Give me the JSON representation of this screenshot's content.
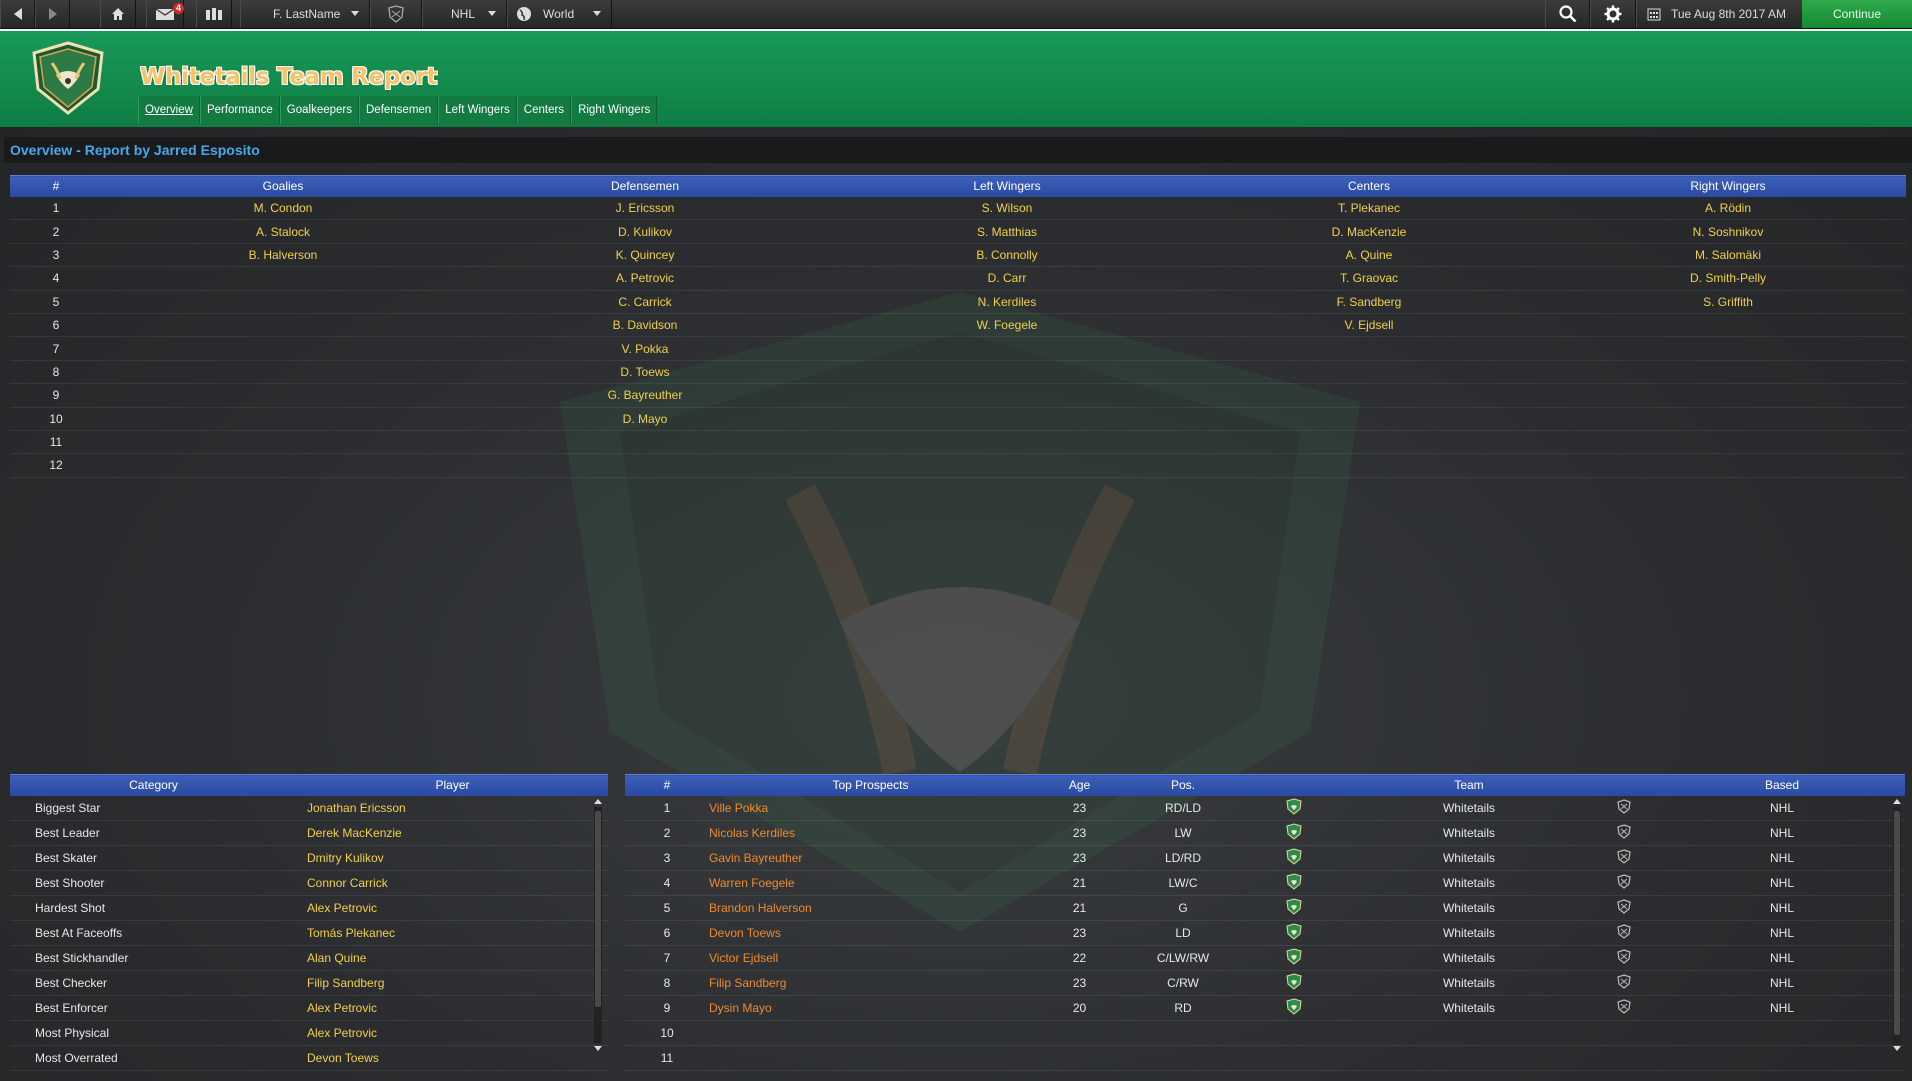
{
  "topbar": {
    "manager_select": "F. LastName",
    "league_select": "NHL",
    "region_select": "World",
    "date": "Tue Aug 8th 2017 AM",
    "continue_label": "Continue",
    "inbox_badge": "4"
  },
  "header": {
    "title": "Whitetails Team Report",
    "tabs": [
      "Overview",
      "Performance",
      "Goalkeepers",
      "Defensemen",
      "Left Wingers",
      "Centers",
      "Right Wingers"
    ]
  },
  "colors": {
    "accent_green": "#189a5a",
    "header_blue": "#2a4aa2",
    "player_yellow": "#f2d04a",
    "prospect_orange": "#ef8a2c",
    "title_blue": "#4aa8e8"
  },
  "overview": {
    "section_title": "Overview - Report by Jarred Esposito",
    "columns": [
      "#",
      "Goalies",
      "Defensemen",
      "Left Wingers",
      "Centers",
      "Right Wingers"
    ],
    "rows": [
      [
        "1",
        "M. Condon",
        "J. Ericsson",
        "S. Wilson",
        "T. Plekanec",
        "A. Rödin"
      ],
      [
        "2",
        "A. Stalock",
        "D. Kulikov",
        "S. Matthias",
        "D. MacKenzie",
        "N. Soshnikov"
      ],
      [
        "3",
        "B. Halverson",
        "K. Quincey",
        "B. Connolly",
        "A. Quine",
        "M. Salomäki"
      ],
      [
        "4",
        "",
        "A. Petrovic",
        "D. Carr",
        "T. Graovac",
        "D. Smith-Pelly"
      ],
      [
        "5",
        "",
        "C. Carrick",
        "N. Kerdiles",
        "F. Sandberg",
        "S. Griffith"
      ],
      [
        "6",
        "",
        "B. Davidson",
        "W. Foegele",
        "V. Ejdsell",
        ""
      ],
      [
        "7",
        "",
        "V. Pokka",
        "",
        "",
        ""
      ],
      [
        "8",
        "",
        "D. Toews",
        "",
        "",
        ""
      ],
      [
        "9",
        "",
        "G. Bayreuther",
        "",
        "",
        ""
      ],
      [
        "10",
        "",
        "D. Mayo",
        "",
        "",
        ""
      ],
      [
        "11",
        "",
        "",
        "",
        "",
        ""
      ],
      [
        "12",
        "",
        "",
        "",
        "",
        ""
      ]
    ]
  },
  "categories": {
    "columns": [
      "Category",
      "Player"
    ],
    "rows": [
      [
        "Biggest Star",
        "Jonathan Ericsson"
      ],
      [
        "Best Leader",
        "Derek MacKenzie"
      ],
      [
        "Best Skater",
        "Dmitry Kulikov"
      ],
      [
        "Best Shooter",
        "Connor Carrick"
      ],
      [
        "Hardest Shot",
        "Alex Petrovic"
      ],
      [
        "Best At Faceoffs",
        "Tomás Plekanec"
      ],
      [
        "Best Stickhandler",
        "Alan Quine"
      ],
      [
        "Best Checker",
        "Filip Sandberg"
      ],
      [
        "Best Enforcer",
        "Alex Petrovic"
      ],
      [
        "Most Physical",
        "Alex Petrovic"
      ],
      [
        "Most Overrated",
        "Devon Toews"
      ]
    ]
  },
  "prospects": {
    "columns": [
      "#",
      "Top Prospects",
      "Age",
      "Pos.",
      "",
      "Team",
      "",
      "Based"
    ],
    "rows": [
      [
        "1",
        "Ville Pokka",
        "23",
        "RD/LD",
        "Whitetails",
        "NHL"
      ],
      [
        "2",
        "Nicolas Kerdiles",
        "23",
        "LW",
        "Whitetails",
        "NHL"
      ],
      [
        "3",
        "Gavin Bayreuther",
        "23",
        "LD/RD",
        "Whitetails",
        "NHL"
      ],
      [
        "4",
        "Warren Foegele",
        "21",
        "LW/C",
        "Whitetails",
        "NHL"
      ],
      [
        "5",
        "Brandon Halverson",
        "21",
        "G",
        "Whitetails",
        "NHL"
      ],
      [
        "6",
        "Devon Toews",
        "23",
        "LD",
        "Whitetails",
        "NHL"
      ],
      [
        "7",
        "Victor Ejdsell",
        "22",
        "C/LW/RW",
        "Whitetails",
        "NHL"
      ],
      [
        "8",
        "Filip Sandberg",
        "23",
        "C/RW",
        "Whitetails",
        "NHL"
      ],
      [
        "9",
        "Dysin Mayo",
        "20",
        "RD",
        "Whitetails",
        "NHL"
      ],
      [
        "10",
        "",
        "",
        "",
        "",
        ""
      ],
      [
        "11",
        "",
        "",
        "",
        "",
        ""
      ]
    ]
  }
}
